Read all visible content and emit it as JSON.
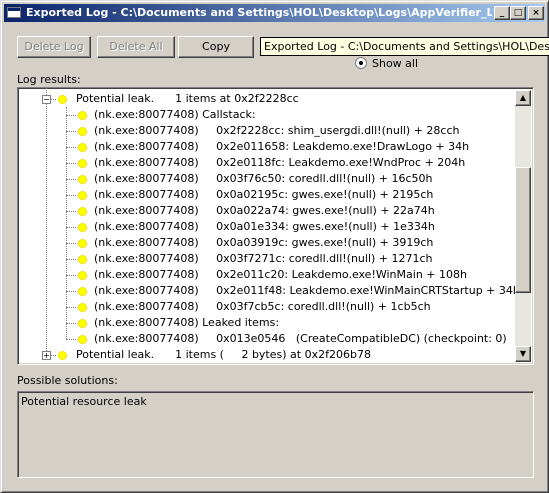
{
  "window": {
    "title": "Exported Log - C:\\Documents and Settings\\HOL\\Desktop\\Logs\\AppVerifier_Leak...",
    "controls": {
      "minimize": "_",
      "maximize": "□",
      "close": "×"
    }
  },
  "toolbar": {
    "delete_log": {
      "label": "Delete Log",
      "enabled": false
    },
    "delete_all": {
      "label": "Delete All",
      "enabled": false
    },
    "copy": {
      "label": "Copy",
      "enabled": true
    }
  },
  "tooltip": "Exported Log - C:\\Documents and Settings\\HOL\\Desktop\\Lo",
  "filter": {
    "show_all_label": "Show all",
    "selected": true
  },
  "log_results": {
    "label": "Log results:",
    "rows": [
      {
        "text": "Potential leak.      1 items at 0x2f2228cc",
        "expander": "−",
        "level": 0
      },
      {
        "text": "(nk.exe:80077408) Callstack:",
        "level": 1
      },
      {
        "text": "(nk.exe:80077408)     0x2f2228cc: shim_usergdi.dll!(null) + 28cch",
        "level": 1
      },
      {
        "text": "(nk.exe:80077408)     0x2e011658: Leakdemo.exe!DrawLogo + 34h",
        "level": 1
      },
      {
        "text": "(nk.exe:80077408)     0x2e0118fc: Leakdemo.exe!WndProc + 204h",
        "level": 1
      },
      {
        "text": "(nk.exe:80077408)     0x03f76c50: coredll.dll!(null) + 16c50h",
        "level": 1
      },
      {
        "text": "(nk.exe:80077408)     0x0a02195c: gwes.exe!(null) + 2195ch",
        "level": 1
      },
      {
        "text": "(nk.exe:80077408)     0x0a022a74: gwes.exe!(null) + 22a74h",
        "level": 1
      },
      {
        "text": "(nk.exe:80077408)     0x0a01e334: gwes.exe!(null) + 1e334h",
        "level": 1
      },
      {
        "text": "(nk.exe:80077408)     0x0a03919c: gwes.exe!(null) + 3919ch",
        "level": 1
      },
      {
        "text": "(nk.exe:80077408)     0x03f7271c: coredll.dll!(null) + 1271ch",
        "level": 1
      },
      {
        "text": "(nk.exe:80077408)     0x2e011c20: Leakdemo.exe!WinMain + 108h",
        "level": 1
      },
      {
        "text": "(nk.exe:80077408)     0x2e011f48: Leakdemo.exe!WinMainCRTStartup + 34h",
        "level": 1
      },
      {
        "text": "(nk.exe:80077408)     0x03f7cb5c: coredll.dll!(null) + 1cb5ch",
        "level": 1
      },
      {
        "text": "(nk.exe:80077408) Leaked items:",
        "level": 1
      },
      {
        "text": "(nk.exe:80077408)     0x013e0546   (CreateCompatibleDC) (checkpoint: 0)",
        "level": 1
      },
      {
        "text": "Potential leak.      1 items (     2 bytes) at 0x2f206b78",
        "expander": "+",
        "level": 0
      }
    ]
  },
  "possible_solutions": {
    "label": "Possible solutions:",
    "text": "Potential resource leak"
  }
}
